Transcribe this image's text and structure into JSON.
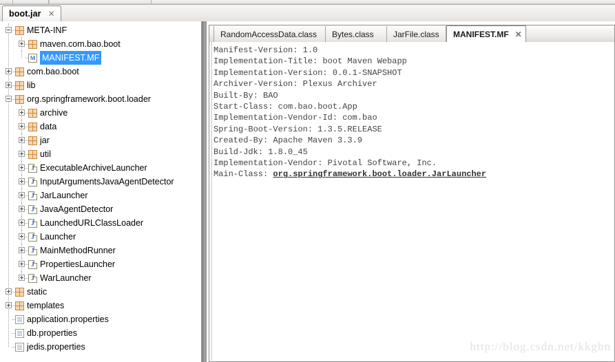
{
  "window": {
    "file_tab": {
      "label": "boot.jar",
      "close_icon": "close-icon"
    }
  },
  "tree": {
    "nodes": [
      {
        "label": "META-INF",
        "depth": 0,
        "icon": "package-icon",
        "expander": "minus",
        "selected": false
      },
      {
        "label": "maven.com.bao.boot",
        "depth": 1,
        "icon": "package-icon",
        "expander": "plus",
        "selected": false
      },
      {
        "label": "MANIFEST.MF",
        "depth": 1,
        "icon": "manifest-file-icon",
        "expander": "none",
        "selected": true
      },
      {
        "label": "com.bao.boot",
        "depth": 0,
        "icon": "package-icon",
        "expander": "plus",
        "selected": false
      },
      {
        "label": "lib",
        "depth": 0,
        "icon": "package-icon",
        "expander": "plus",
        "selected": false
      },
      {
        "label": "org.springframework.boot.loader",
        "depth": 0,
        "icon": "package-icon",
        "expander": "minus",
        "selected": false
      },
      {
        "label": "archive",
        "depth": 1,
        "icon": "package-icon",
        "expander": "plus",
        "selected": false
      },
      {
        "label": "data",
        "depth": 1,
        "icon": "package-icon",
        "expander": "plus",
        "selected": false
      },
      {
        "label": "jar",
        "depth": 1,
        "icon": "package-icon",
        "expander": "plus",
        "selected": false
      },
      {
        "label": "util",
        "depth": 1,
        "icon": "package-icon",
        "expander": "plus",
        "selected": false
      },
      {
        "label": "ExecutableArchiveLauncher",
        "depth": 1,
        "icon": "java-class-icon",
        "expander": "plus",
        "selected": false
      },
      {
        "label": "InputArgumentsJavaAgentDetector",
        "depth": 1,
        "icon": "java-class-icon",
        "expander": "plus",
        "selected": false
      },
      {
        "label": "JarLauncher",
        "depth": 1,
        "icon": "java-class-icon",
        "expander": "plus",
        "selected": false
      },
      {
        "label": "JavaAgentDetector",
        "depth": 1,
        "icon": "java-class-icon",
        "expander": "plus",
        "selected": false
      },
      {
        "label": "LaunchedURLClassLoader",
        "depth": 1,
        "icon": "java-class-icon",
        "expander": "plus",
        "selected": false
      },
      {
        "label": "Launcher",
        "depth": 1,
        "icon": "java-class-icon",
        "expander": "plus",
        "selected": false
      },
      {
        "label": "MainMethodRunner",
        "depth": 1,
        "icon": "java-class-icon",
        "expander": "plus",
        "selected": false
      },
      {
        "label": "PropertiesLauncher",
        "depth": 1,
        "icon": "java-class-icon",
        "expander": "plus",
        "selected": false
      },
      {
        "label": "WarLauncher",
        "depth": 1,
        "icon": "java-class-icon",
        "expander": "plus",
        "selected": false
      },
      {
        "label": "static",
        "depth": 0,
        "icon": "package-icon",
        "expander": "plus",
        "selected": false
      },
      {
        "label": "templates",
        "depth": 0,
        "icon": "package-icon",
        "expander": "plus",
        "selected": false
      },
      {
        "label": "application.properties",
        "depth": 0,
        "icon": "file-icon",
        "expander": "none",
        "selected": false
      },
      {
        "label": "db.properties",
        "depth": 0,
        "icon": "file-icon",
        "expander": "none",
        "selected": false
      },
      {
        "label": "jedis.properties",
        "depth": 0,
        "icon": "file-icon",
        "expander": "none",
        "selected": false
      }
    ]
  },
  "editor": {
    "tabs": [
      {
        "label": "RandomAccessData.class",
        "active": false,
        "closable": false
      },
      {
        "label": "Bytes.class",
        "active": false,
        "closable": false
      },
      {
        "label": "JarFile.class",
        "active": false,
        "closable": false
      },
      {
        "label": "MANIFEST.MF",
        "active": true,
        "closable": true,
        "close_icon": "close-icon"
      }
    ],
    "content": {
      "lines": [
        "Manifest-Version: 1.0",
        "Implementation-Title: boot Maven Webapp",
        "Implementation-Version: 0.0.1-SNAPSHOT",
        "Archiver-Version: Plexus Archiver",
        "Built-By: BAO",
        "Start-Class: com.bao.boot.App",
        "Implementation-Vendor-Id: com.bao",
        "Spring-Boot-Version: 1.3.5.RELEASE",
        "Created-By: Apache Maven 3.3.9",
        "Build-Jdk: 1.8.0_45",
        "Implementation-Vendor: Pivotal Software, Inc."
      ],
      "last_line_key": "Main-Class: ",
      "last_line_link": "org.springframework.boot.loader.JarLauncher"
    }
  },
  "watermark": {
    "text": "http://blog.csdn.net/kkgbn"
  },
  "colors": {
    "selection": "#3399ff",
    "package_icon": "#f6d6b3",
    "package_icon_border": "#c98a42",
    "code_text": "#444444",
    "panel_border": "#8e8e8e"
  }
}
